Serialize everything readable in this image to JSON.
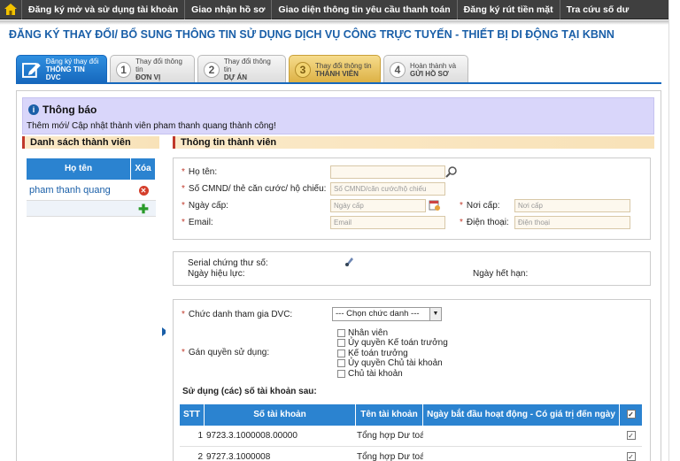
{
  "nav": {
    "items": [
      "Đăng ký mở và sử dụng tài khoản",
      "Giao nhận hồ sơ",
      "Giao diện thông tin yêu cầu thanh toán",
      "Đăng ký rút tiền mặt",
      "Tra cứu số dư"
    ]
  },
  "page_title": "ĐĂNG KÝ THAY ĐỔI/ BỔ SUNG THÔNG TIN SỬ DỤNG DỊCH VỤ CÔNG TRỰC TUYẾN - THIẾT BỊ DI ĐỘNG TẠI KBNN",
  "wizard": [
    {
      "num": "",
      "line1": "Đăng ký thay đổi",
      "line2": "THÔNG TIN DVC"
    },
    {
      "num": "1",
      "line1": "Thay đổi thông tin",
      "line2": "ĐƠN VỊ"
    },
    {
      "num": "2",
      "line1": "Thay đổi thông tin",
      "line2": "DỰ ÁN"
    },
    {
      "num": "3",
      "line1": "Thay đổi thông tin",
      "line2": "THÀNH VIÊN"
    },
    {
      "num": "4",
      "line1": "Hoàn thành và",
      "line2": "GỬI HỒ SƠ"
    }
  ],
  "notice": {
    "title": "Thông báo",
    "message": "Thêm mới/ Cập nhật thành viên pham thanh quang thành công!"
  },
  "members": {
    "title": "Danh sách thành viên",
    "col_name": "Họ tên",
    "col_delete": "Xóa",
    "rows": [
      {
        "name": "pham thanh quang"
      }
    ]
  },
  "info": {
    "title": "Thông tin thành viên",
    "ho_ten": "Họ tên:",
    "cmnd": "Số CMND/ thẻ căn cước/ hộ chiếu:",
    "cmnd_ph": "Số CMND/căn cước/hộ chiếu",
    "ngay_cap": "Ngày cấp:",
    "ngay_cap_ph": "Ngày cấp",
    "noi_cap": "Nơi cấp:",
    "noi_cap_ph": "Nơi cấp",
    "email": "Email:",
    "email_ph": "Email",
    "dien_thoai": "Điện thoại:",
    "dien_thoai_ph": "Điện thoại"
  },
  "cert": {
    "serial": "Serial chứng thư số:",
    "hieu_luc": "Ngày hiệu lực:",
    "het_han": "Ngày hết hạn:"
  },
  "role": {
    "chuc_danh": "Chức danh tham gia DVC:",
    "chuc_danh_value": "--- Chọn chức danh ---",
    "gan_quyen": "Gán quyền sử dụng:",
    "options": [
      "Nhân viên",
      "Ủy quyền Kế toán trưởng",
      "Kế toán trưởng",
      "Ủy quyền Chủ tài khoản",
      "Chủ tài khoản"
    ]
  },
  "accounts": {
    "title": "Sử dụng (các) số tài khoản sau:",
    "headers": [
      "STT",
      "Số tài khoản",
      "Tên tài khoản",
      "Ngày bắt đầu hoạt động - Có giá trị đến ngày"
    ],
    "rows": [
      {
        "stt": "1",
        "so": "9723.3.1000008.00000",
        "ten": "Tổng hợp Dư toá"
      },
      {
        "stt": "2",
        "so": "9727.3.1000008",
        "ten": "Tổng hợp Dư toá"
      }
    ]
  },
  "colors": {
    "nav_bg": "#3f3f3f",
    "title": "#1a5fa8",
    "header_blue": "#2b83d0",
    "notice_bg": "#d9d6fa",
    "section_bg": "#fbe9c8",
    "active_step": "#dcb043"
  }
}
